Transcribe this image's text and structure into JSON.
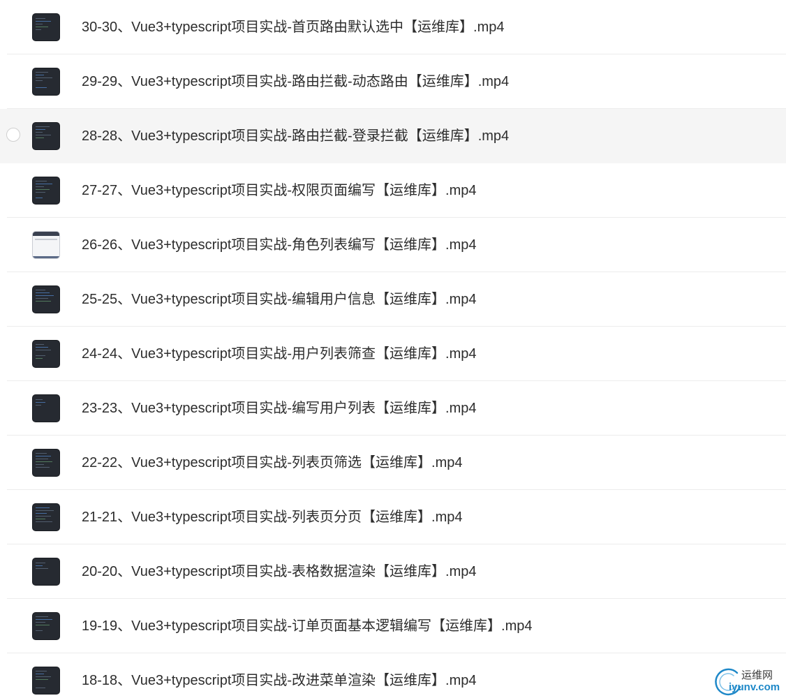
{
  "files": [
    {
      "name": "30-30、Vue3+typescript项目实战-首页路由默认选中【运维库】.mp4",
      "thumbnail": "video-thumbnail"
    },
    {
      "name": "29-29、Vue3+typescript项目实战-路由拦截-动态路由【运维库】.mp4",
      "thumbnail": "video-thumbnail"
    },
    {
      "name": "28-28、Vue3+typescript项目实战-路由拦截-登录拦截【运维库】.mp4",
      "thumbnail": "video-thumbnail",
      "hovered": true
    },
    {
      "name": "27-27、Vue3+typescript项目实战-权限页面编写【运维库】.mp4",
      "thumbnail": "video-thumbnail"
    },
    {
      "name": "26-26、Vue3+typescript项目实战-角色列表编写【运维库】.mp4",
      "thumbnail": "light-thumbnail"
    },
    {
      "name": "25-25、Vue3+typescript项目实战-编辑用户信息【运维库】.mp4",
      "thumbnail": "video-thumbnail"
    },
    {
      "name": "24-24、Vue3+typescript项目实战-用户列表筛查【运维库】.mp4",
      "thumbnail": "video-thumbnail"
    },
    {
      "name": "23-23、Vue3+typescript项目实战-编写用户列表【运维库】.mp4",
      "thumbnail": "video-thumbnail"
    },
    {
      "name": "22-22、Vue3+typescript项目实战-列表页筛选【运维库】.mp4",
      "thumbnail": "video-thumbnail"
    },
    {
      "name": "21-21、Vue3+typescript项目实战-列表页分页【运维库】.mp4",
      "thumbnail": "video-thumbnail"
    },
    {
      "name": "20-20、Vue3+typescript项目实战-表格数据渲染【运维库】.mp4",
      "thumbnail": "video-thumbnail"
    },
    {
      "name": "19-19、Vue3+typescript项目实战-订单页面基本逻辑编写【运维库】.mp4",
      "thumbnail": "video-thumbnail"
    },
    {
      "name": "18-18、Vue3+typescript项目实战-改进菜单渲染【运维库】.mp4",
      "thumbnail": "video-thumbnail"
    }
  ],
  "watermark": {
    "top_text": "运维网",
    "bottom_text": "iyunv.com",
    "accent": "#1e88c8"
  },
  "colors": {
    "hover_row": "#f5f5f5",
    "divider": "#ececec",
    "text": "#2d2d2d"
  }
}
